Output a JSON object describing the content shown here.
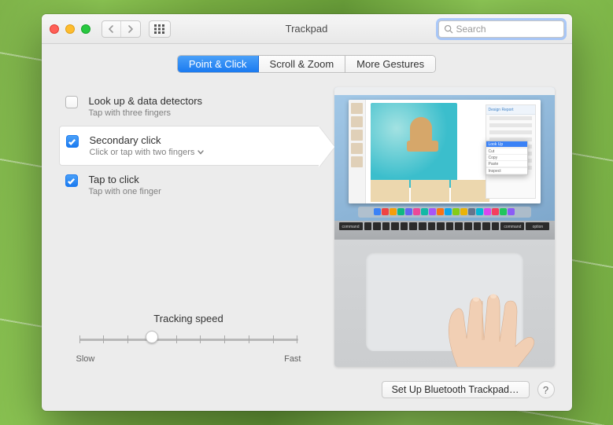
{
  "window": {
    "title": "Trackpad"
  },
  "search": {
    "placeholder": "Search"
  },
  "tabs": [
    {
      "label": "Point & Click",
      "active": true
    },
    {
      "label": "Scroll & Zoom",
      "active": false
    },
    {
      "label": "More Gestures",
      "active": false
    }
  ],
  "options": [
    {
      "title": "Look up & data detectors",
      "subtitle": "Tap with three fingers",
      "checked": false,
      "selected": false,
      "dropdown": false
    },
    {
      "title": "Secondary click",
      "subtitle": "Click or tap with two fingers",
      "checked": true,
      "selected": true,
      "dropdown": true
    },
    {
      "title": "Tap to click",
      "subtitle": "Tap with one finger",
      "checked": true,
      "selected": false,
      "dropdown": false
    }
  ],
  "tracking": {
    "label": "Tracking speed",
    "ticks": 10,
    "value_index": 3,
    "min_label": "Slow",
    "max_label": "Fast"
  },
  "footer": {
    "setup_label": "Set Up Bluetooth Trackpad…",
    "help_label": "?"
  },
  "preview": {
    "context_menu_items": [
      "Look Up",
      "",
      "Cut",
      "Copy",
      "Paste",
      "",
      "Inspect"
    ],
    "dock_colors": [
      "#3b82f6",
      "#ef4444",
      "#f59e0b",
      "#10b981",
      "#6366f1",
      "#ec4899",
      "#14b8a6",
      "#a855f7",
      "#f97316",
      "#0ea5e9",
      "#84cc16",
      "#eab308",
      "#64748b",
      "#06b6d4",
      "#d946ef",
      "#f43f5e",
      "#22c55e",
      "#8b5cf6"
    ],
    "key_labels": [
      "command",
      "",
      "",
      "",
      "",
      "",
      "",
      "",
      "",
      "",
      "",
      "",
      "",
      "",
      "",
      "",
      "command",
      "option"
    ]
  }
}
